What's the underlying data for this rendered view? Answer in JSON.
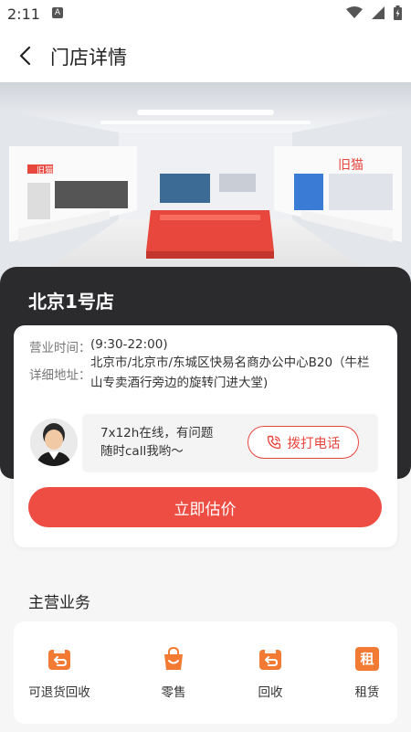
{
  "status_bar": {
    "time": "2:11",
    "app_badge": "A"
  },
  "header": {
    "title": "门店详情"
  },
  "store": {
    "name": "北京1号店",
    "hours_label": "营业时间：",
    "hours_value": "(9:30-22:00)",
    "address_label": "详细地址：",
    "address_value": "北京市/北京市/东城区快易名商办公中心B20（牛栏山专卖酒行旁边的旋转门进大堂)",
    "contact_line1": "7x12h在线，有问题",
    "contact_line2": "随时call我哟～",
    "call_label": "拨打电话",
    "estimate_label": "立即估价"
  },
  "image_signs": {
    "left": "旧猫",
    "right": "旧猫"
  },
  "business": {
    "title": "主营业务",
    "items": [
      {
        "label": "可退货回收",
        "icon": "return-box-icon"
      },
      {
        "label": "零售",
        "icon": "shopping-bag-icon"
      },
      {
        "label": "回收",
        "icon": "recycle-box-icon"
      },
      {
        "label": "租赁",
        "icon": "rent-icon",
        "glyph": "租"
      }
    ]
  },
  "colors": {
    "accent": "#ee4d43",
    "icon_orange": "#f27a33",
    "dark_card": "#2b2b2d"
  }
}
